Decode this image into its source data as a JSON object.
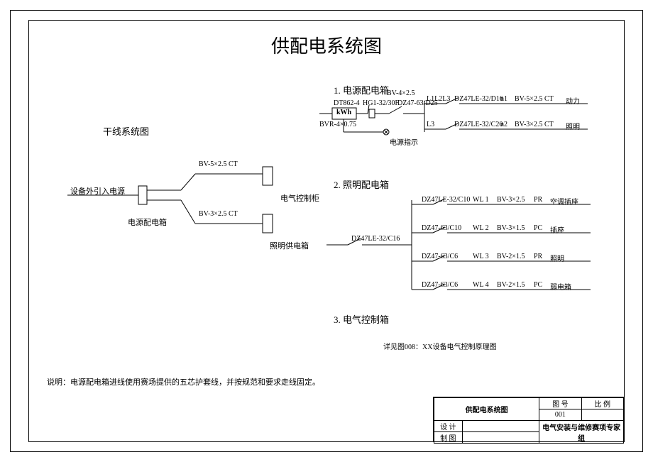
{
  "title": "供配电系统图",
  "sections": {
    "trunk_title": "干线系统图",
    "box1_title": "1. 电源配电箱",
    "box2_title": "2. 照明配电箱",
    "box3_title": "3. 电气控制箱"
  },
  "trunk": {
    "ext_power": "设备外引入电源",
    "dist_box": "电源配电箱",
    "cabinet": "电气控制柜",
    "light_box": "照明供电箱",
    "wire1": "BV-5×2.5  CT",
    "wire2": "BV-3×2.5  CT"
  },
  "box1": {
    "meter_model": "DT862-4",
    "meter_label": "kWh",
    "wire_in": "BVR-4×0.75",
    "fuse": "HG1-32/30F",
    "indicator": "电源指示",
    "main_switch": "DZ47-63/D25",
    "wire_top": "BV-4×2.5",
    "bus_top": "L1L2L3",
    "bus_bot": "L3",
    "out1_sw": "DZ47LE-32/D16",
    "out1_n": "n1",
    "out1_wire": "BV-5×2.5  CT",
    "out1_name": "动力",
    "out2_sw": "DZ47LE-32/C20",
    "out2_n": "n2",
    "out2_wire": "BV-3×2.5  CT",
    "out2_name": "照明"
  },
  "box2": {
    "main_sw": "DZ47LE-32/C16",
    "rows": [
      {
        "sw": "DZ47LE-32/C10",
        "wl": "WL 1",
        "wire": "BV-3×2.5",
        "via": "PR",
        "name": "空调插座"
      },
      {
        "sw": "DZ47-63/C10",
        "wl": "WL 2",
        "wire": "BV-3×1.5",
        "via": "PC",
        "name": "插座"
      },
      {
        "sw": "DZ47-63/C6",
        "wl": "WL 3",
        "wire": "BV-2×1.5",
        "via": "PR",
        "name": "照明"
      },
      {
        "sw": "DZ47-63/C6",
        "wl": "WL 4",
        "wire": "BV-2×1.5",
        "via": "PC",
        "name": "弱电箱"
      }
    ]
  },
  "box3_note": "详见图008：XX设备电气控制原理图",
  "note": "说明：电源配电箱进线使用赛场提供的五芯护套线，并按规范和要求走线固定。",
  "titleblock": {
    "drawing_name": "供配电系统图",
    "col_no": "图  号",
    "col_scale": "比  例",
    "no": "001",
    "scale": "",
    "design": "设  计",
    "draft": "制  图",
    "team": "电气安装与维修赛项专家组"
  }
}
